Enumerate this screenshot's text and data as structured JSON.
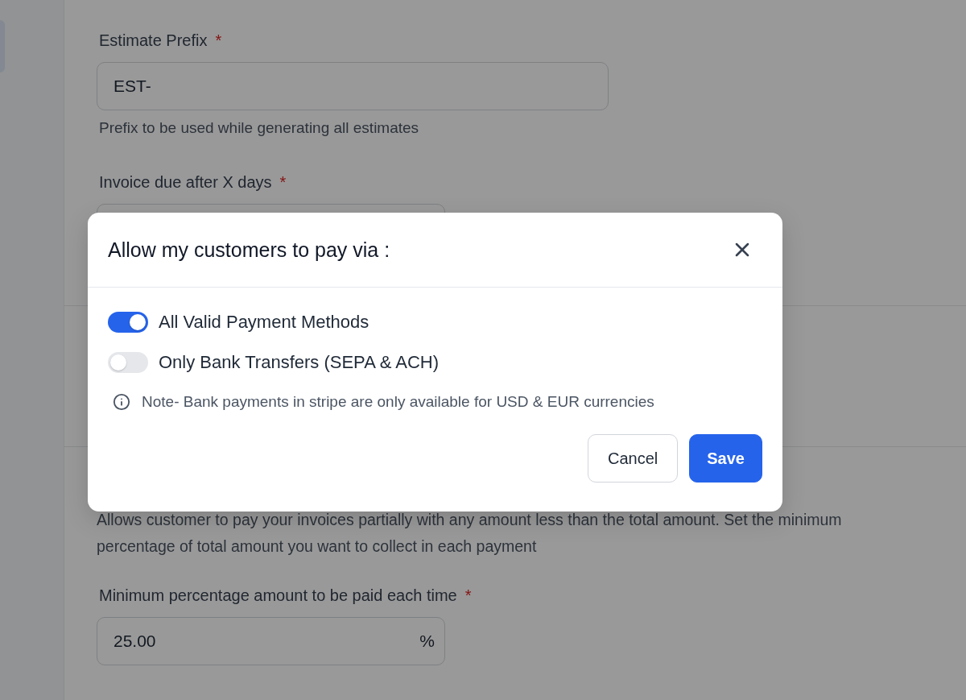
{
  "sidebar": {
    "items": [
      {
        "selected": true
      }
    ]
  },
  "estimate_prefix": {
    "label": "Estimate Prefix",
    "required_mark": "*",
    "value": "EST-",
    "help": "Prefix to be used while generating all estimates"
  },
  "invoice_due": {
    "label": "Invoice due after X days",
    "required_mark": "*"
  },
  "partial_payment": {
    "description": "Allows customer to pay your invoices partially with any amount less than the total amount. Set the minimum percentage of total amount you want to collect in each payment",
    "minimum_percentage": {
      "label": "Minimum percentage amount to be paid each time",
      "required_mark": "*",
      "value": "25.00",
      "suffix": "%"
    }
  },
  "dialog": {
    "title": "Allow my customers to pay via :",
    "options": [
      {
        "label": "All Valid Payment Methods",
        "on": true
      },
      {
        "label": "Only Bank Transfers (SEPA & ACH)",
        "on": false
      }
    ],
    "note": "Note- Bank payments in stripe are only available for USD & EUR currencies",
    "buttons": [
      {
        "label": "Cancel",
        "kind": "secondary"
      },
      {
        "label": "Save",
        "kind": "primary"
      }
    ]
  }
}
